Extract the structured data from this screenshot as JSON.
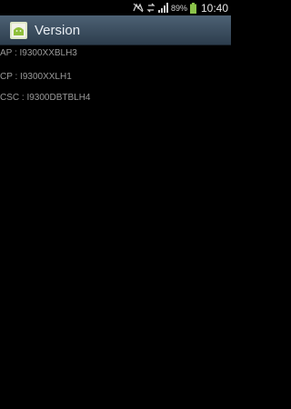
{
  "status_bar": {
    "battery_percent": "89%",
    "time": "10:40",
    "battery_color": "#8bc34a"
  },
  "header": {
    "title": "Version",
    "accent": "#4d6174"
  },
  "versions": [
    {
      "label": "AP : I9300XXBLH3"
    },
    {
      "label": "CP : I9300XXLH1"
    },
    {
      "label": "CSC : I9300DBTBLH4"
    }
  ]
}
